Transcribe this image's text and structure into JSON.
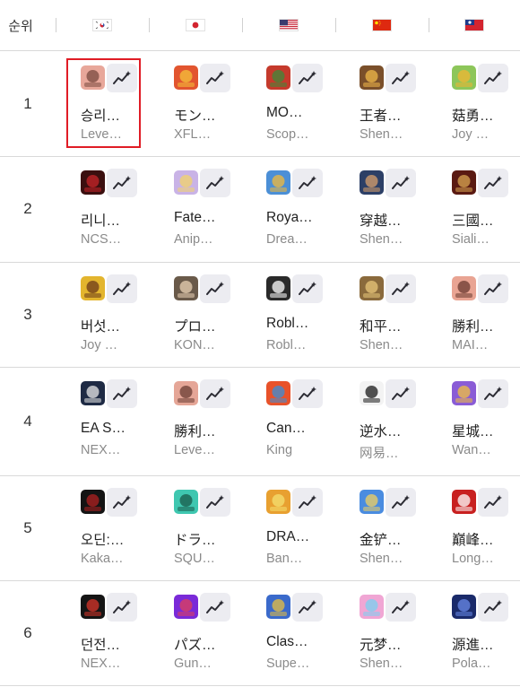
{
  "header": {
    "rank_label": "순위",
    "countries": [
      {
        "name": "south-korea",
        "flag": "kr-flag-icon"
      },
      {
        "name": "japan",
        "flag": "jp-flag-icon"
      },
      {
        "name": "united-states",
        "flag": "us-flag-icon"
      },
      {
        "name": "china",
        "flag": "cn-flag-icon"
      },
      {
        "name": "taiwan",
        "flag": "tw-flag-icon"
      }
    ]
  },
  "rows": [
    {
      "rank": "1",
      "apps": [
        {
          "name": "승리…",
          "publisher": "Leve…",
          "icon_color": "#e8a79a",
          "icon_accent": "#7a4a3f"
        },
        {
          "name": "モン…",
          "publisher": "XFL…",
          "icon_color": "#e2552f",
          "icon_accent": "#f4c23b"
        },
        {
          "name": "MO…",
          "publisher": "Scop…",
          "icon_color": "#c53a2c",
          "icon_accent": "#3c8a3a"
        },
        {
          "name": "王者…",
          "publisher": "Shen…",
          "icon_color": "#7a4f2a",
          "icon_accent": "#f0b84a"
        },
        {
          "name": "菇勇…",
          "publisher": "Joy …",
          "icon_color": "#8dc65a",
          "icon_accent": "#f1b533"
        }
      ]
    },
    {
      "rank": "2",
      "apps": [
        {
          "name": "리니…",
          "publisher": "NCS…",
          "icon_color": "#3b0f0f",
          "icon_accent": "#c8252a"
        },
        {
          "name": "Fate…",
          "publisher": "Anip…",
          "icon_color": "#c9b3e6",
          "icon_accent": "#f2d36a"
        },
        {
          "name": "Roya…",
          "publisher": "Drea…",
          "icon_color": "#4b8fd6",
          "icon_accent": "#f2b93a"
        },
        {
          "name": "穿越…",
          "publisher": "Shen…",
          "icon_color": "#2c3f66",
          "icon_accent": "#d8a06c"
        },
        {
          "name": "三國…",
          "publisher": "Siali…",
          "icon_color": "#5a1a12",
          "icon_accent": "#d9a552"
        }
      ]
    },
    {
      "rank": "3",
      "apps": [
        {
          "name": "버섯…",
          "publisher": "Joy …",
          "icon_color": "#e3b52e",
          "icon_accent": "#6c3a1a"
        },
        {
          "name": "プロ…",
          "publisher": "KON…",
          "icon_color": "#6a5a4a",
          "icon_accent": "#e9d2b4"
        },
        {
          "name": "Robl…",
          "publisher": "Robl…",
          "icon_color": "#2a2a2a",
          "icon_accent": "#ffffff"
        },
        {
          "name": "和平…",
          "publisher": "Shen…",
          "icon_color": "#8a6a3c",
          "icon_accent": "#e8c77a"
        },
        {
          "name": "勝利…",
          "publisher": "MAI…",
          "icon_color": "#e9a493",
          "icon_accent": "#6a3a30"
        }
      ]
    },
    {
      "rank": "4",
      "apps": [
        {
          "name": "EA S…",
          "publisher": "NEX…",
          "icon_color": "#1e2a44",
          "icon_accent": "#e8e8e8"
        },
        {
          "name": "勝利…",
          "publisher": "Leve…",
          "icon_color": "#e5a697",
          "icon_accent": "#6a3c33"
        },
        {
          "name": "Can…",
          "publisher": "King",
          "icon_color": "#e8522a",
          "icon_accent": "#3a8fd8"
        },
        {
          "name": "逆水…",
          "publisher": "网易…",
          "icon_color": "#f3f3f3",
          "icon_accent": "#1a1a1a"
        },
        {
          "name": "星城…",
          "publisher": "Wan…",
          "icon_color": "#8a5cd6",
          "icon_accent": "#f0c040"
        }
      ]
    },
    {
      "rank": "5",
      "apps": [
        {
          "name": "오딘:…",
          "publisher": "Kaka…",
          "icon_color": "#141414",
          "icon_accent": "#b02020"
        },
        {
          "name": "ドラ…",
          "publisher": "SQU…",
          "icon_color": "#3fc7b0",
          "icon_accent": "#1a5a4a"
        },
        {
          "name": "DRA…",
          "publisher": "Ban…",
          "icon_color": "#e8a030",
          "icon_accent": "#f4e070"
        },
        {
          "name": "金铲…",
          "publisher": "Shen…",
          "icon_color": "#4a8ce0",
          "icon_accent": "#f2d060"
        },
        {
          "name": "巔峰…",
          "publisher": "Long…",
          "icon_color": "#c82020",
          "icon_accent": "#ffffff"
        }
      ]
    },
    {
      "rank": "6",
      "apps": [
        {
          "name": "던전…",
          "publisher": "NEX…",
          "icon_color": "#151515",
          "icon_accent": "#d8342a"
        },
        {
          "name": "パズ…",
          "publisher": "Gun…",
          "icon_color": "#7a2ad8",
          "icon_accent": "#e0405a"
        },
        {
          "name": "Clas…",
          "publisher": "Supe…",
          "icon_color": "#3a6acb",
          "icon_accent": "#e8c040"
        },
        {
          "name": "元梦…",
          "publisher": "Shen…",
          "icon_color": "#f0a6d4",
          "icon_accent": "#7ad0f0"
        },
        {
          "name": "源進…",
          "publisher": "Pola…",
          "icon_color": "#1a2a6a",
          "icon_accent": "#6a8ae8"
        }
      ]
    }
  ],
  "colors": {
    "highlight": "#e01c25",
    "trend_button_bg": "#ececf1",
    "divider": "#d9d9d9"
  },
  "icons": {
    "trend_button": "sparkle-trend-icon"
  }
}
